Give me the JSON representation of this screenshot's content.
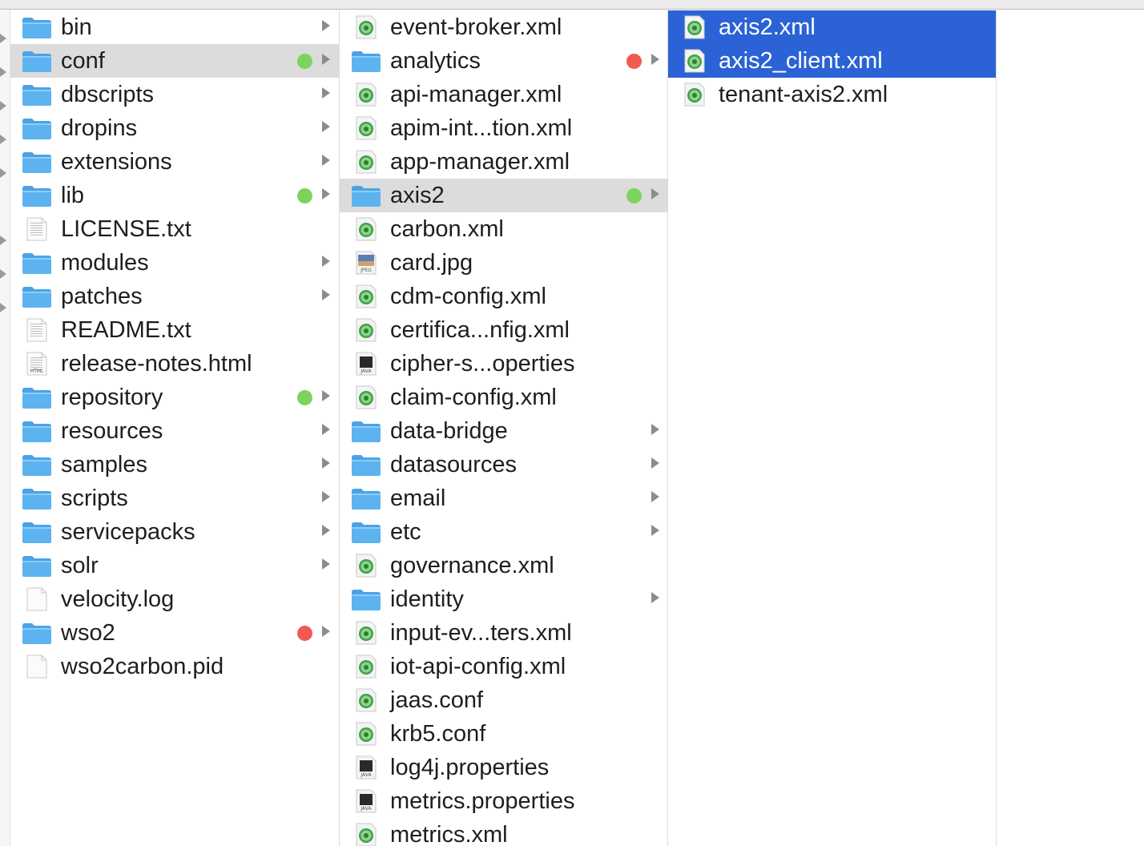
{
  "colors": {
    "selection_blue": "#2b63d6",
    "selection_gray": "#dcdcdc",
    "tag_green": "#7dd45c",
    "tag_red": "#ef5b53",
    "folder_blue": "#5cb3ef"
  },
  "columns": [
    {
      "items": [
        {
          "name": "bin",
          "icon": "folder-icon",
          "arrow": true
        },
        {
          "name": "conf",
          "icon": "folder-icon",
          "arrow": true,
          "tag": "green",
          "selected": "gray"
        },
        {
          "name": "dbscripts",
          "icon": "folder-icon",
          "arrow": true
        },
        {
          "name": "dropins",
          "icon": "folder-icon",
          "arrow": true
        },
        {
          "name": "extensions",
          "icon": "folder-icon",
          "arrow": true
        },
        {
          "name": "lib",
          "icon": "folder-icon",
          "arrow": true,
          "tag": "green"
        },
        {
          "name": "LICENSE.txt",
          "icon": "text-file-icon"
        },
        {
          "name": "modules",
          "icon": "folder-icon",
          "arrow": true
        },
        {
          "name": "patches",
          "icon": "folder-icon",
          "arrow": true
        },
        {
          "name": "README.txt",
          "icon": "text-file-icon"
        },
        {
          "name": "release-notes.html",
          "icon": "html-file-icon"
        },
        {
          "name": "repository",
          "icon": "folder-icon",
          "arrow": true,
          "tag": "green"
        },
        {
          "name": "resources",
          "icon": "folder-icon",
          "arrow": true
        },
        {
          "name": "samples",
          "icon": "folder-icon",
          "arrow": true
        },
        {
          "name": "scripts",
          "icon": "folder-icon",
          "arrow": true
        },
        {
          "name": "servicepacks",
          "icon": "folder-icon",
          "arrow": true
        },
        {
          "name": "solr",
          "icon": "folder-icon",
          "arrow": true
        },
        {
          "name": "velocity.log",
          "icon": "blank-file-icon"
        },
        {
          "name": "wso2",
          "icon": "folder-icon",
          "arrow": true,
          "tag": "red"
        },
        {
          "name": "wso2carbon.pid",
          "icon": "blank-file-icon"
        }
      ]
    },
    {
      "items": [
        {
          "name": "event-broker.xml",
          "icon": "xml-file-icon"
        },
        {
          "name": "analytics",
          "icon": "folder-icon",
          "arrow": true,
          "tag": "red"
        },
        {
          "name": "api-manager.xml",
          "icon": "xml-file-icon"
        },
        {
          "name": "apim-int...tion.xml",
          "icon": "xml-file-icon"
        },
        {
          "name": "app-manager.xml",
          "icon": "xml-file-icon"
        },
        {
          "name": "axis2",
          "icon": "folder-icon",
          "arrow": true,
          "tag": "green",
          "selected": "gray"
        },
        {
          "name": "carbon.xml",
          "icon": "xml-file-icon"
        },
        {
          "name": "card.jpg",
          "icon": "jpeg-file-icon",
          "badge": "JPEG"
        },
        {
          "name": "cdm-config.xml",
          "icon": "xml-file-icon"
        },
        {
          "name": "certifica...nfig.xml",
          "icon": "xml-file-icon"
        },
        {
          "name": "cipher-s...operties",
          "icon": "java-file-icon",
          "badge": "JAVA"
        },
        {
          "name": "claim-config.xml",
          "icon": "xml-file-icon"
        },
        {
          "name": "data-bridge",
          "icon": "folder-icon",
          "arrow": true
        },
        {
          "name": "datasources",
          "icon": "folder-icon",
          "arrow": true
        },
        {
          "name": "email",
          "icon": "folder-icon",
          "arrow": true
        },
        {
          "name": "etc",
          "icon": "folder-icon",
          "arrow": true
        },
        {
          "name": "governance.xml",
          "icon": "xml-file-icon"
        },
        {
          "name": "identity",
          "icon": "folder-icon",
          "arrow": true
        },
        {
          "name": "input-ev...ters.xml",
          "icon": "xml-file-icon"
        },
        {
          "name": "iot-api-config.xml",
          "icon": "xml-file-icon"
        },
        {
          "name": "jaas.conf",
          "icon": "xml-file-icon"
        },
        {
          "name": "krb5.conf",
          "icon": "xml-file-icon"
        },
        {
          "name": "log4j.properties",
          "icon": "java-file-icon",
          "badge": "JAVA"
        },
        {
          "name": "metrics.properties",
          "icon": "java-file-icon",
          "badge": "JAVA"
        },
        {
          "name": "metrics.xml",
          "icon": "xml-file-icon"
        }
      ]
    },
    {
      "items": [
        {
          "name": "axis2.xml",
          "icon": "xml-file-icon",
          "selected": "blue"
        },
        {
          "name": "axis2_client.xml",
          "icon": "xml-file-icon",
          "selected": "blue"
        },
        {
          "name": "tenant-axis2.xml",
          "icon": "xml-file-icon"
        }
      ]
    }
  ],
  "html_badge": "HTML"
}
